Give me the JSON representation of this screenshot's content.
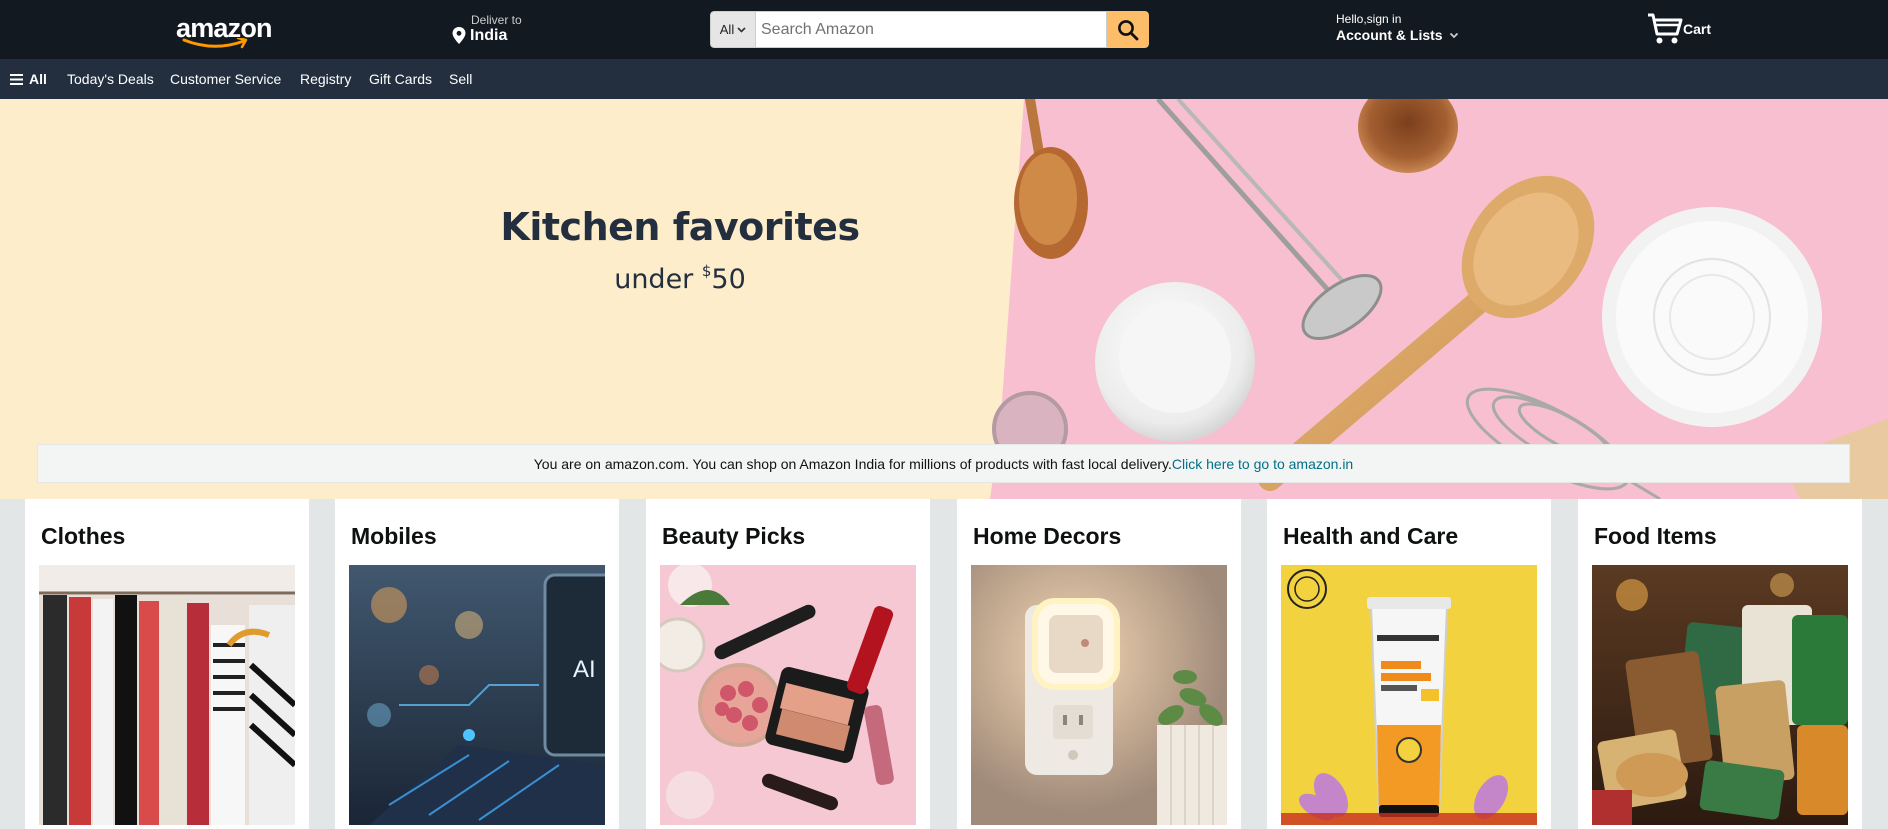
{
  "header": {
    "logo": "amazon",
    "deliver_to_label": "Deliver to",
    "deliver_to_location": "India",
    "search_category": "All",
    "search_placeholder": "Search Amazon",
    "account_greeting": "Hello,sign in",
    "account_lists": "Account & Lists",
    "cart_label": "Cart"
  },
  "nav": {
    "all_label": "All",
    "items": [
      "Today's Deals",
      "Customer Service",
      "Registry",
      "Gift Cards",
      "Sell"
    ]
  },
  "hero": {
    "title": "Kitchen favorites",
    "subtitle_prefix": "under ",
    "subtitle_currency": "$",
    "subtitle_amount": "50",
    "notice_text": "You are on amazon.com. You can shop on Amazon India for millions of products with fast local delivery.",
    "notice_link": "Click here to go to amazon.in"
  },
  "categories": [
    {
      "title": "Clothes"
    },
    {
      "title": "Mobiles"
    },
    {
      "title": "Beauty Picks"
    },
    {
      "title": "Home Decors"
    },
    {
      "title": "Health and Care"
    },
    {
      "title": "Food Items"
    }
  ],
  "colors": {
    "nav_top": "#131921",
    "nav_main": "#232f3e",
    "search_button": "#febd69",
    "hero_bg": "#fdedcb",
    "hero_photo_bg": "#f7bfd0",
    "link": "#007185"
  }
}
